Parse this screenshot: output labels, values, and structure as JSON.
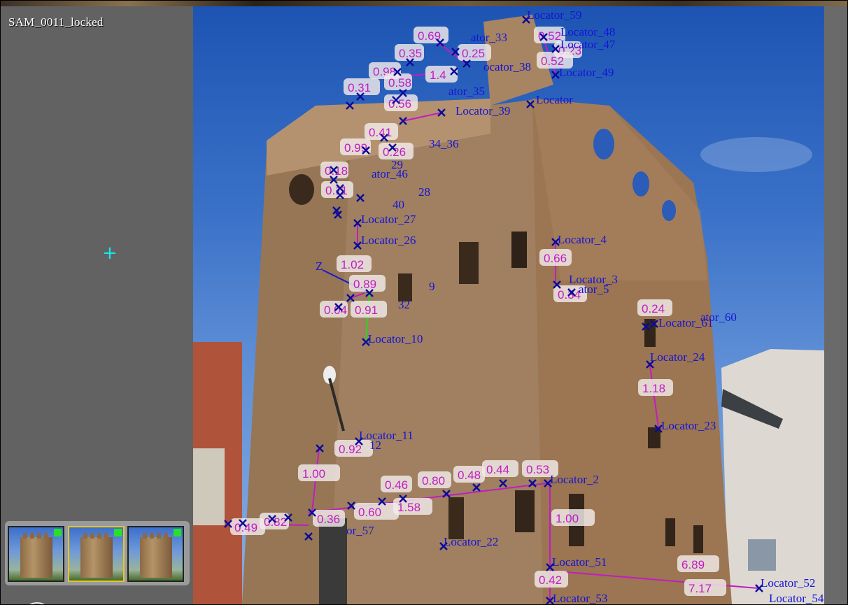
{
  "camera": {
    "title": "SAM_0011_locked"
  },
  "thumbnails": [
    {
      "name": "thumb-1",
      "selected": false,
      "flag": "green"
    },
    {
      "name": "thumb-2",
      "selected": true,
      "flag": "green"
    },
    {
      "name": "thumb-3",
      "selected": false,
      "flag": "green"
    }
  ],
  "colors": {
    "locator": "#1414d6",
    "distance": "#c21cc2",
    "axis_x": "#1a1acc",
    "axis_y": "#27d627",
    "selected_thumb": "#e7c52a",
    "crosshair": "#19e6ee"
  },
  "locators": {
    "l59": "Locator_59",
    "l48": "Locator_48",
    "l47": "Locator_47",
    "l49": "Locator_49",
    "l33": "ator_33",
    "l38": "ocator_38",
    "l35": "ator_35",
    "l39": "Locator_39",
    "lplain": "Locator",
    "l36": "34_36",
    "l46": "ator_46",
    "l28": "28",
    "l40": "40",
    "l27": "Locator_27",
    "l26": "Locator_26",
    "l4": "Locator_4",
    "l3": "Locator_3",
    "l5": "ator_5",
    "l9": "9",
    "l32": "32",
    "l10": "Locator_10",
    "l60": "ator_60",
    "l61": "Locator_61",
    "l24": "Locator_24",
    "l23": "Locator_23",
    "l11": "Locator_11",
    "l12": "12",
    "l2": "Locator_2",
    "l22": "Locator_22",
    "l51": "Locator_51",
    "l53": "Locator_53",
    "l52": "Locator_52",
    "l54": "Locator_54",
    "l57": "or_57",
    "l29": "29"
  },
  "distances": {
    "d069": "0.69",
    "d052a": "0.52",
    "d035": "0.35",
    "d025": "0.25",
    "d023": "0.23",
    "d052b": "0.52",
    "d098": "0.98",
    "d14": "1.4",
    "d058": "0.58",
    "d031": "0.31",
    "d056": "0.56",
    "d041": "0.41",
    "d099": "0.99",
    "d026": "0.26",
    "d018": "0.18",
    "d011": "0.11",
    "d102": "1.02",
    "d089": "0.89",
    "d004": "0.04",
    "d091": "0.91",
    "d066": "0.66",
    "d034": "0.34",
    "d024": "0.24",
    "d118": "1.18",
    "d092": "0.92",
    "d100a": "1.00",
    "d100b": "1.00",
    "d046": "0.46",
    "d080": "0.80",
    "d048": "0.48",
    "d044": "0.44",
    "d053": "0.53",
    "d049": "0.49",
    "d082": "0.82",
    "d036": "0.36",
    "d060": "0.60",
    "d158": "1.58",
    "d042": "0.42",
    "d689": "6.89",
    "d717": "7.17"
  },
  "axes": {
    "z": "Z"
  }
}
